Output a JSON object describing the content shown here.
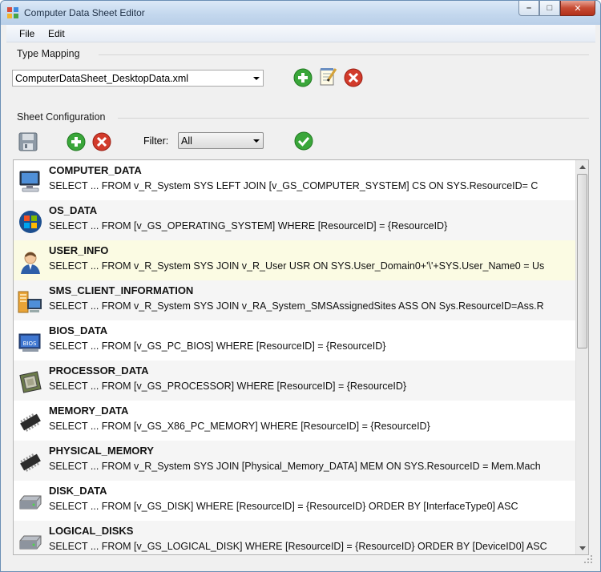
{
  "window": {
    "title": "Computer Data Sheet Editor"
  },
  "caption": {
    "minimize": "–",
    "maximize": "□",
    "close": "✕"
  },
  "menu": {
    "file": "File",
    "edit": "Edit"
  },
  "type_mapping": {
    "label": "Type Mapping",
    "selected": "ComputerDataSheet_DesktopData.xml",
    "icons": [
      "add-icon",
      "edit-notepad-icon",
      "delete-icon"
    ]
  },
  "sheet_config": {
    "label": "Sheet Configuration",
    "filter_label": "Filter:",
    "filter_value": "All",
    "icons": [
      "save-icon",
      "add-icon",
      "delete-icon",
      "apply-check-icon"
    ]
  },
  "colors": {
    "green": "#3aa63a",
    "red": "#d23b2b",
    "selected_row": "#fbfbe3",
    "alt_row": "#f5f5f5"
  },
  "rows": [
    {
      "name": "COMPUTER_DATA",
      "sql": "SELECT ... FROM  v_R_System SYS LEFT JOIN [v_GS_COMPUTER_SYSTEM] CS ON SYS.ResourceID= C",
      "icon": "computer-icon"
    },
    {
      "name": "OS_DATA",
      "sql": "SELECT ... FROM  [v_GS_OPERATING_SYSTEM] WHERE [ResourceID] = {ResourceID}",
      "icon": "windows-logo-icon"
    },
    {
      "name": "USER_INFO",
      "sql": "SELECT ... FROM  v_R_System SYS JOIN v_R_User USR ON SYS.User_Domain0+'\\'+SYS.User_Name0 = Us",
      "icon": "user-icon"
    },
    {
      "name": "SMS_CLIENT_INFORMATION",
      "sql": "SELECT ... FROM  v_R_System SYS JOIN v_RA_System_SMSAssignedSites ASS ON Sys.ResourceID=Ass.R",
      "icon": "sms-client-icon"
    },
    {
      "name": "BIOS_DATA",
      "sql": "SELECT ... FROM  [v_GS_PC_BIOS] WHERE [ResourceID] = {ResourceID}",
      "icon": "bios-icon",
      "icon_text": "BIOS"
    },
    {
      "name": "PROCESSOR_DATA",
      "sql": "SELECT ... FROM  [v_GS_PROCESSOR] WHERE [ResourceID] = {ResourceID}",
      "icon": "processor-icon"
    },
    {
      "name": "MEMORY_DATA",
      "sql": "SELECT ... FROM  [v_GS_X86_PC_MEMORY] WHERE [ResourceID] = {ResourceID}",
      "icon": "memory-chip-icon"
    },
    {
      "name": "PHYSICAL_MEMORY",
      "sql": "SELECT ... FROM  v_R_System SYS JOIN [Physical_Memory_DATA] MEM ON SYS.ResourceID = Mem.Mach",
      "icon": "memory-chip-icon"
    },
    {
      "name": "DISK_DATA",
      "sql": "SELECT ... FROM  [v_GS_DISK] WHERE [ResourceID] = {ResourceID} ORDER BY [InterfaceType0] ASC",
      "icon": "hard-disk-icon"
    },
    {
      "name": "LOGICAL_DISKS",
      "sql": "SELECT ... FROM  [v_GS_LOGICAL_DISK] WHERE [ResourceID] = {ResourceID} ORDER BY [DeviceID0] ASC",
      "icon": "hard-disk-icon"
    }
  ]
}
